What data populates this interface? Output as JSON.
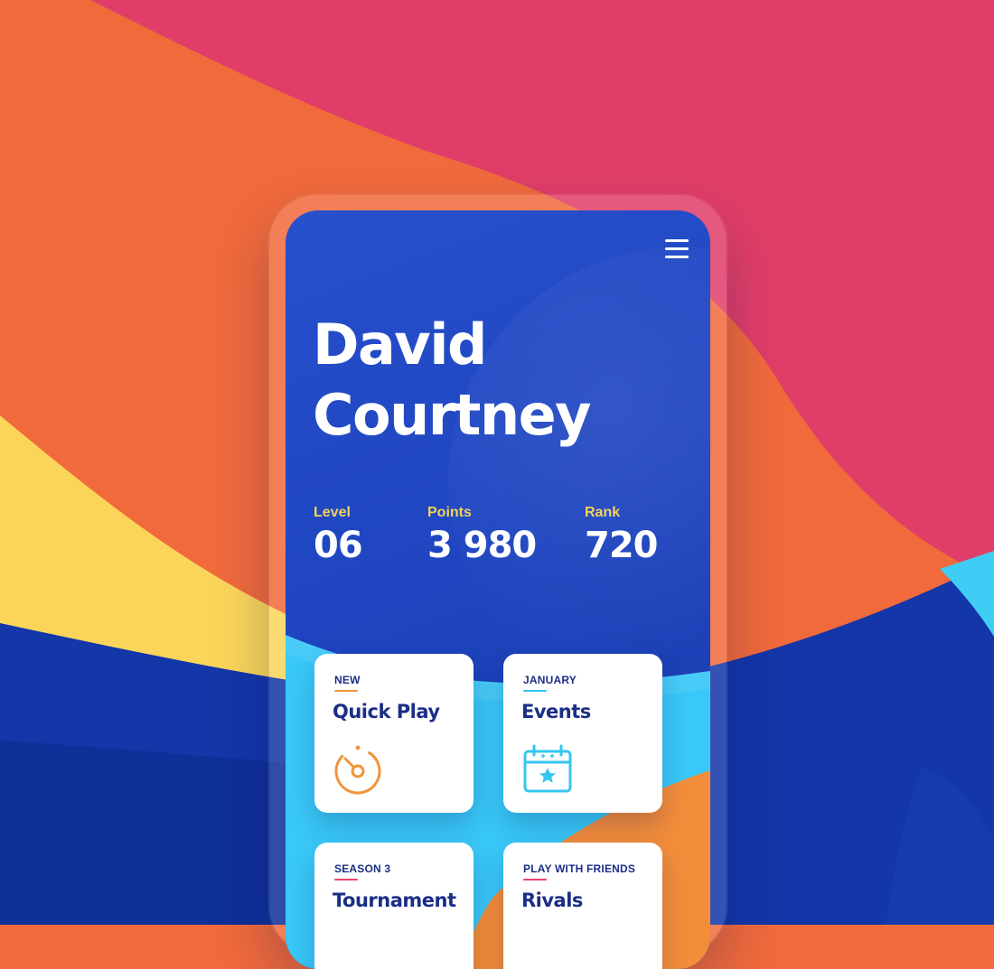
{
  "profile": {
    "first_name": "David",
    "last_name": "Courtney"
  },
  "stats": [
    {
      "label": "Level",
      "value": "06"
    },
    {
      "label": "Points",
      "value": "3 980"
    },
    {
      "label": "Rank",
      "value": "720"
    }
  ],
  "cards": [
    {
      "kicker": "NEW",
      "title": "Quick Play",
      "icon": "dial-icon",
      "accent": "#f2943a"
    },
    {
      "kicker": "JANUARY",
      "title": "Events",
      "icon": "calendar-star-icon",
      "accent": "#35c6f0"
    },
    {
      "kicker": "SEASON 3",
      "title": "Tournament",
      "icon": "",
      "accent": "#e8456b"
    },
    {
      "kicker": "PLAY WITH FRIENDS",
      "title": "Rivals",
      "icon": "",
      "accent": "#e8456b"
    }
  ],
  "colors": {
    "screen_blue": "#2249c4",
    "label_yellow": "#f2d35a",
    "card_title_navy": "#1b2e86",
    "bg_orange": "#f06a3c",
    "bg_pink": "#e03e68",
    "bg_yellow": "#fbd55a",
    "bg_navy": "#1336a8",
    "bg_cyan": "#3fcdf6"
  }
}
